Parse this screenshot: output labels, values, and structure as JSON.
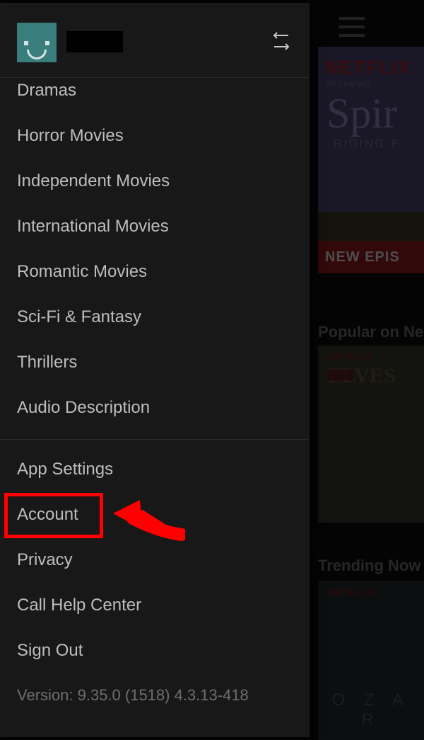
{
  "background": {
    "section2_title": "Popular on Ne",
    "section3_title": "Trending Now",
    "tile1": {
      "brand": "NETFLIX",
      "studio": "DREAMWO",
      "title": "Spir",
      "subtitle": "RIDING F",
      "banner": "NEW EPIS"
    },
    "tile2": {
      "brand": "NETFLIX",
      "lego": "LEGO",
      "title": "ELVES"
    },
    "tile3": {
      "brand": "NETFLIX",
      "title": "O Z A R"
    }
  },
  "sidebar": {
    "categories": [
      "Dramas",
      "Horror Movies",
      "Independent Movies",
      "International Movies",
      "Romantic Movies",
      "Sci-Fi & Fantasy",
      "Thrillers",
      "Audio Description"
    ],
    "settings": [
      "App Settings",
      "Account",
      "Privacy",
      "Call Help Center",
      "Sign Out"
    ],
    "version": "Version: 9.35.0 (1518) 4.3.13-418"
  },
  "annotation": {
    "highlight_target": "Account"
  }
}
